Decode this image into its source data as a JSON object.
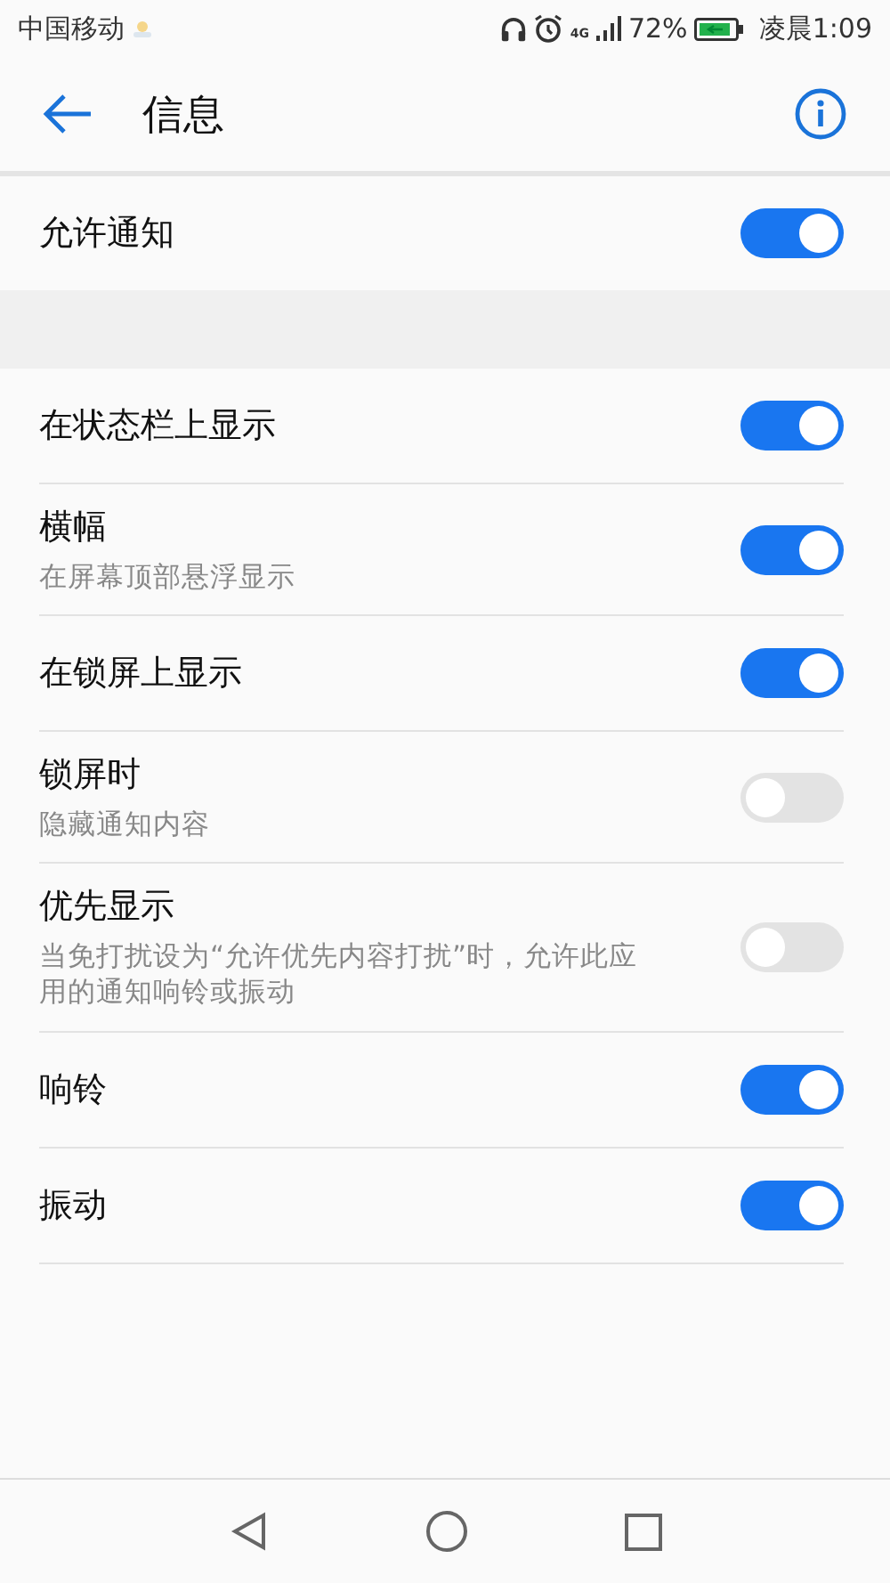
{
  "status_bar": {
    "carrier": "中国移动",
    "network": "4G",
    "battery": "72%",
    "time": "凌晨1:09"
  },
  "app_bar": {
    "title": "信息"
  },
  "sections": [
    {
      "rows": [
        {
          "title": "允许通知",
          "on": true
        }
      ]
    },
    {
      "rows": [
        {
          "title": "在状态栏上显示",
          "on": true
        },
        {
          "title": "横幅",
          "subtitle": "在屏幕顶部悬浮显示",
          "on": true
        },
        {
          "title": "在锁屏上显示",
          "on": true
        },
        {
          "title": "锁屏时",
          "subtitle": "隐藏通知内容",
          "on": false
        },
        {
          "title": "优先显示",
          "subtitle": "当免打扰设为“允许优先内容打扰”时，允许此应用的通知响铃或振动",
          "on": false
        },
        {
          "title": "响铃",
          "on": true
        },
        {
          "title": "振动",
          "on": true
        }
      ]
    }
  ]
}
